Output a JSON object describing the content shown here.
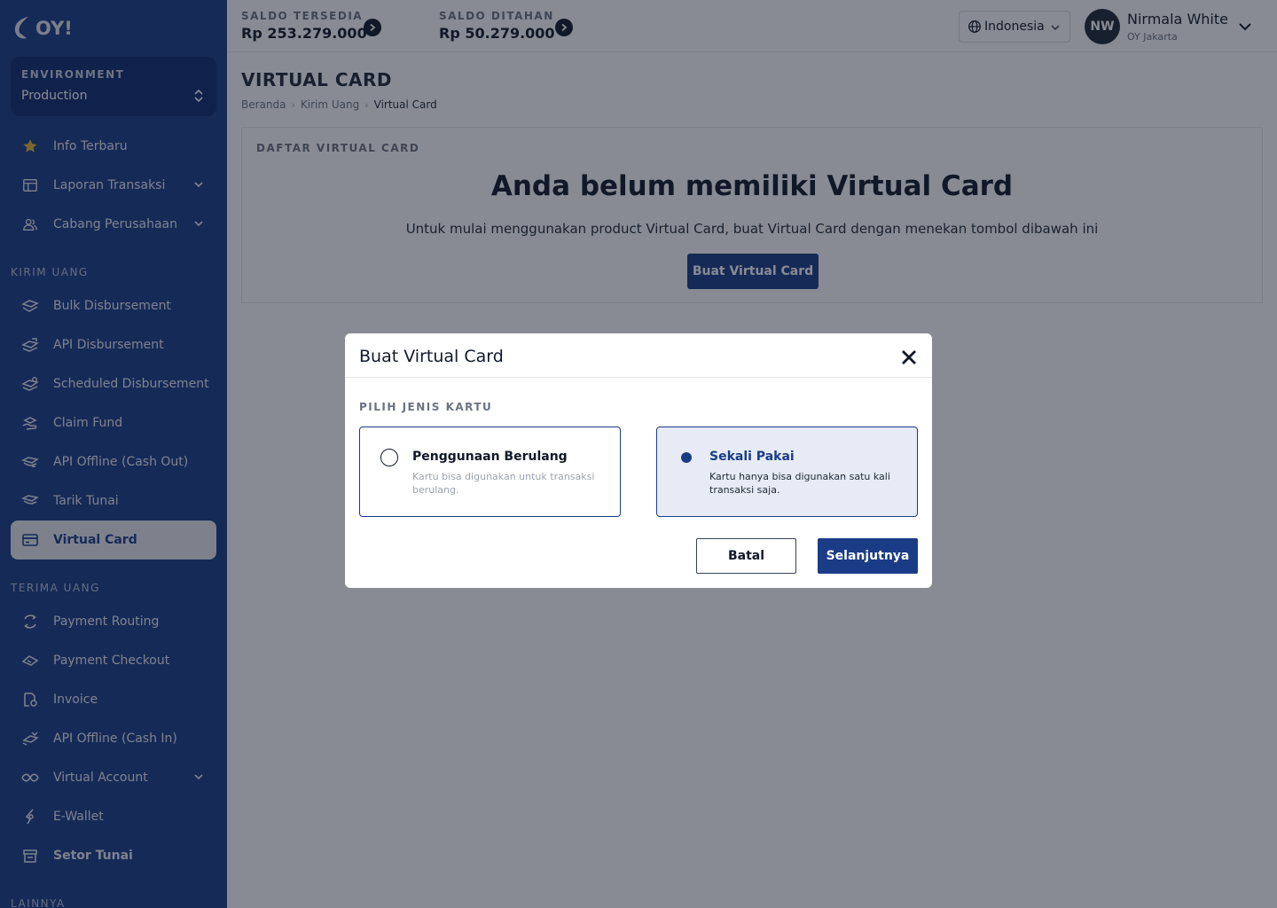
{
  "app": {
    "logo_text": "OY!"
  },
  "sidebar": {
    "environment": {
      "label": "ENVIRONMENT",
      "value": "Production"
    },
    "items_top": [
      {
        "label": "Info Terbaru",
        "icon": "star-icon"
      },
      {
        "label": "Laporan Transaksi",
        "icon": "table-icon",
        "expandable": true
      },
      {
        "label": "Cabang Perusahaan",
        "icon": "users-icon",
        "expandable": true
      }
    ],
    "sections": [
      {
        "label": "KIRIM UANG",
        "items": [
          {
            "label": "Bulk Disbursement",
            "icon": "money-send-icon"
          },
          {
            "label": "API Disbursement",
            "icon": "money-api-icon"
          },
          {
            "label": "Scheduled Disbursement",
            "icon": "money-schedule-icon"
          },
          {
            "label": "Claim Fund",
            "icon": "hand-money-icon"
          },
          {
            "label": "API Offline (Cash Out)",
            "icon": "cash-out-icon"
          },
          {
            "label": "Tarik Tunai",
            "icon": "withdraw-icon"
          },
          {
            "label": "Virtual Card",
            "icon": "card-icon",
            "active": true
          }
        ]
      },
      {
        "label": "TERIMA UANG",
        "items": [
          {
            "label": "Payment Routing",
            "icon": "routing-icon"
          },
          {
            "label": "Payment Checkout",
            "icon": "checkout-icon"
          },
          {
            "label": "Invoice",
            "icon": "invoice-icon"
          },
          {
            "label": "API Offline (Cash In)",
            "icon": "cash-in-icon"
          },
          {
            "label": "Virtual Account",
            "icon": "virtual-account-icon",
            "expandable": true
          },
          {
            "label": "E-Wallet",
            "icon": "wallet-icon"
          },
          {
            "label": "Setor Tunai",
            "icon": "store-icon"
          }
        ]
      },
      {
        "label": "LAINNYA",
        "items": []
      }
    ]
  },
  "topbar": {
    "balance_available": {
      "label": "SALDO TERSEDIA",
      "value": "Rp 253.279.000"
    },
    "balance_held": {
      "label": "SALDO DITAHAN",
      "value": "Rp 50.279.000"
    },
    "language": "Indonesia",
    "user": {
      "initials": "NW",
      "name": "Nirmala White",
      "location": "OY Jakarta"
    }
  },
  "main": {
    "page_title": "VIRTUAL CARD",
    "breadcrumb": [
      "Beranda",
      "Kirim Uang",
      "Virtual Card"
    ],
    "card": {
      "section_label": "DAFTAR VIRTUAL CARD",
      "empty_title": "Anda belum memiliki Virtual Card",
      "empty_desc": "Untuk mulai menggunakan product Virtual Card, buat Virtual Card dengan menekan tombol dibawah ini",
      "create_button": "Buat Virtual Card"
    }
  },
  "modal": {
    "title": "Buat Virtual Card",
    "section_label": "PILIH JENIS KARTU",
    "options": [
      {
        "title": "Penggunaan Berulang",
        "desc": "Kartu bisa digunakan untuk transaksi berulang.",
        "selected": false
      },
      {
        "title": "Sekali Pakai",
        "desc": "Kartu hanya bisa digunakan satu kali transaksi saja.",
        "selected": true
      }
    ],
    "cancel_label": "Batal",
    "next_label": "Selanjutnya"
  },
  "colors": {
    "sidebar_bg": "#1a3c87",
    "primary": "#1a3c87",
    "star": "#e8b930",
    "overlay": "rgba(17,24,39,0.5)"
  }
}
